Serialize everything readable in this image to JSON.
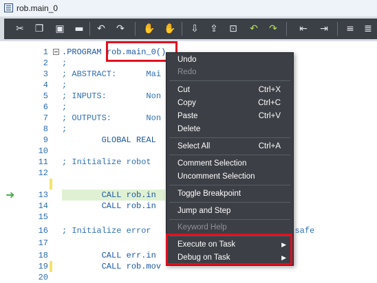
{
  "window": {
    "title": "rob.main_0"
  },
  "toolbar": {
    "icons": [
      "cut-icon",
      "copy-icon",
      "paste-icon",
      "delete-icon",
      "undo-icon",
      "redo-icon",
      "breakpoint-icon",
      "remove-breakpoint-icon",
      "step-in-icon",
      "step-over-icon",
      "step-out-icon",
      "indent-icon",
      "outdent-icon",
      "comment-icon",
      "uncomment-icon",
      "align-left-icon",
      "align-right-icon"
    ]
  },
  "editor": {
    "lines": [
      {
        "n": "1",
        "text": ".PROGRAM rob.main_0()"
      },
      {
        "n": "2",
        "text": ";"
      },
      {
        "n": "3",
        "text": "; ABSTRACT:      Mai                   ogram"
      },
      {
        "n": "4",
        "text": ";"
      },
      {
        "n": "5",
        "text": "; INPUTS:        Non"
      },
      {
        "n": "6",
        "text": ";"
      },
      {
        "n": "7",
        "text": "; OUTPUTS:       Non"
      },
      {
        "n": "8",
        "text": ";"
      },
      {
        "n": "9",
        "text": "        GLOBAL REAL"
      },
      {
        "n": "10",
        "text": ""
      },
      {
        "n": "11",
        "text": "; Initialize robot                 ies"
      },
      {
        "n": "12",
        "text": ""
      },
      {
        "n": "13",
        "text": "        CALL rob.in"
      },
      {
        "n": "14",
        "text": "        CALL rob.in"
      },
      {
        "n": "15",
        "text": ""
      },
      {
        "n": "16",
        "text": "; Initialize error                  robot to a safe"
      },
      {
        "n": "17",
        "text": ""
      },
      {
        "n": "18",
        "text": "        CALL err.in"
      },
      {
        "n": "19",
        "text": "        CALL rob.mov"
      },
      {
        "n": "20",
        "text": ""
      }
    ]
  },
  "context_menu": {
    "items": [
      {
        "label": "Undo",
        "shortcut": "",
        "enabled": true
      },
      {
        "label": "Redo",
        "shortcut": "",
        "enabled": false
      },
      {
        "label": "Cut",
        "shortcut": "Ctrl+X",
        "enabled": true
      },
      {
        "label": "Copy",
        "shortcut": "Ctrl+C",
        "enabled": true
      },
      {
        "label": "Paste",
        "shortcut": "Ctrl+V",
        "enabled": true
      },
      {
        "label": "Delete",
        "shortcut": "",
        "enabled": true
      },
      {
        "label": "Select All",
        "shortcut": "Ctrl+A",
        "enabled": true
      },
      {
        "label": "Comment Selection",
        "shortcut": "",
        "enabled": true
      },
      {
        "label": "Uncomment Selection",
        "shortcut": "",
        "enabled": true
      },
      {
        "label": "Toggle Breakpoint",
        "shortcut": "",
        "enabled": true
      },
      {
        "label": "Jump and Step",
        "shortcut": "",
        "enabled": true
      },
      {
        "label": "Keyword Help",
        "shortcut": "",
        "enabled": false
      },
      {
        "label": "Execute on Task",
        "shortcut": "",
        "enabled": true
      },
      {
        "label": "Debug on Task",
        "shortcut": "",
        "enabled": true
      }
    ]
  },
  "colors": {
    "highlight": "#e10e1e",
    "menu_bg": "#3c3f45",
    "code": "#1b56a8"
  }
}
